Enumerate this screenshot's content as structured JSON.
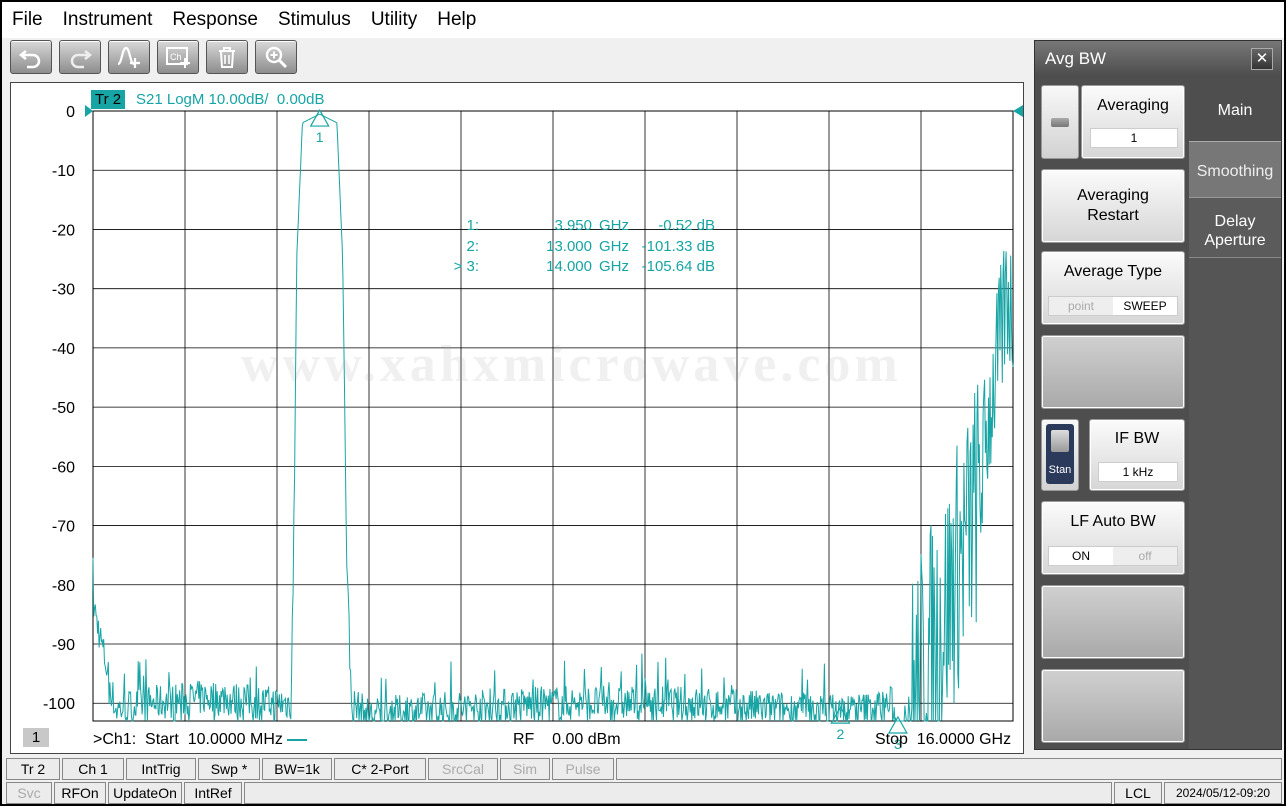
{
  "menu": [
    "File",
    "Instrument",
    "Response",
    "Stimulus",
    "Utility",
    "Help"
  ],
  "toolbar": [
    {
      "name": "undo-button",
      "icon": "undo-icon"
    },
    {
      "name": "redo-button",
      "icon": "redo-icon"
    },
    {
      "name": "add-marker-button",
      "icon": "marker-add-icon"
    },
    {
      "name": "add-channel-button",
      "icon": "channel-add-icon"
    },
    {
      "name": "delete-button",
      "icon": "trash-icon"
    },
    {
      "name": "zoom-button",
      "icon": "zoom-in-icon"
    }
  ],
  "trace": {
    "badge": "Tr 2",
    "description": "S21 LogM 10.00dB/  0.00dB",
    "color": "#17a4a4"
  },
  "markers": [
    {
      "id": "1:",
      "freq": "3.950",
      "unit": "GHz",
      "value": "-0.52 dB"
    },
    {
      "id": "2:",
      "freq": "13.000",
      "unit": "GHz",
      "value": "-101.33 dB"
    },
    {
      "id": "> 3:",
      "freq": "14.000",
      "unit": "GHz",
      "value": "-105.64 dB"
    }
  ],
  "watermark": "www.xahxmicrowave.com",
  "channel_number": "1",
  "footer": {
    "start": ">Ch1:  Start  10.0000 MHz",
    "rf": "RF    0.00 dBm",
    "stop": "Stop  16.0000 GHz"
  },
  "chart_data": {
    "type": "line",
    "xlim": [
      0.01,
      16.0
    ],
    "ylim": [
      -103,
      0
    ],
    "yticks": [
      "0",
      "-10",
      "-20",
      "-30",
      "-40",
      "-50",
      "-60",
      "-70",
      "-80",
      "-90",
      "-100"
    ],
    "y_tick_values": [
      0,
      -10,
      -20,
      -30,
      -40,
      -50,
      -60,
      -70,
      -80,
      -90,
      -100
    ],
    "grid": true,
    "series": [
      {
        "x": [
          0.01,
          0.4,
          1.0,
          2.0,
          3.0,
          3.45,
          3.5,
          3.55,
          3.65,
          3.95,
          4.25,
          4.35,
          4.42,
          4.5,
          4.8,
          6.0,
          8.0,
          10.0,
          12.0,
          13.0,
          13.5,
          13.9,
          14.0,
          14.2,
          14.4,
          14.6,
          14.8,
          15.0,
          15.2,
          15.4,
          15.6,
          15.8,
          15.9,
          16.0
        ],
        "y": [
          -83,
          -101,
          -100,
          -99,
          -100,
          -100,
          -75,
          -25,
          -2,
          -0.52,
          -2,
          -25,
          -75,
          -100,
          -102,
          -101,
          -100,
          -100,
          -101,
          -101.33,
          -101,
          -100,
          -105.64,
          -100,
          -95,
          -90,
          -85,
          -78,
          -72,
          -65,
          -50,
          -38,
          -30,
          -35
        ]
      }
    ],
    "markers": [
      {
        "label": "1",
        "x": 3.95,
        "y": -0.52
      },
      {
        "label": "2",
        "x": 13.0,
        "y": -101.33
      },
      {
        "label": "3",
        "x": 14.0,
        "y": -105.64
      }
    ]
  },
  "panel": {
    "title": "Avg BW",
    "close": "✕",
    "softkeys": {
      "averaging_label": "Averaging",
      "averaging_value": "1",
      "restart_label_1": "Averaging",
      "restart_label_2": "Restart",
      "avg_type_label": "Average Type",
      "avg_type_opt1": "point",
      "avg_type_opt2": "SWEEP",
      "ifbw_label": "IF BW",
      "ifbw_value": "1 kHz",
      "ifbw_side": "Stan",
      "lfauto_label": "LF Auto BW",
      "lfauto_on": "ON",
      "lfauto_off": "off"
    },
    "tabs": {
      "main": "Main",
      "smoothing": "Smoothing",
      "delay_1": "Delay",
      "delay_2": "Aperture"
    }
  },
  "status1": [
    {
      "label": "Tr 2",
      "dim": false
    },
    {
      "label": "Ch 1",
      "dim": false
    },
    {
      "label": "IntTrig",
      "dim": false
    },
    {
      "label": "Swp *",
      "dim": false
    },
    {
      "label": "BW=1k",
      "dim": false
    },
    {
      "label": "C* 2-Port",
      "dim": false
    },
    {
      "label": "SrcCal",
      "dim": true
    },
    {
      "label": "Sim",
      "dim": true
    },
    {
      "label": "Pulse",
      "dim": true
    }
  ],
  "status2": [
    {
      "label": "Svc",
      "dim": true
    },
    {
      "label": "RFOn",
      "dim": false
    },
    {
      "label": "UpdateOn",
      "dim": false
    },
    {
      "label": "IntRef",
      "dim": false
    }
  ],
  "status2_right": {
    "lcl": "LCL",
    "datetime": "2024/05/12-09:20"
  }
}
